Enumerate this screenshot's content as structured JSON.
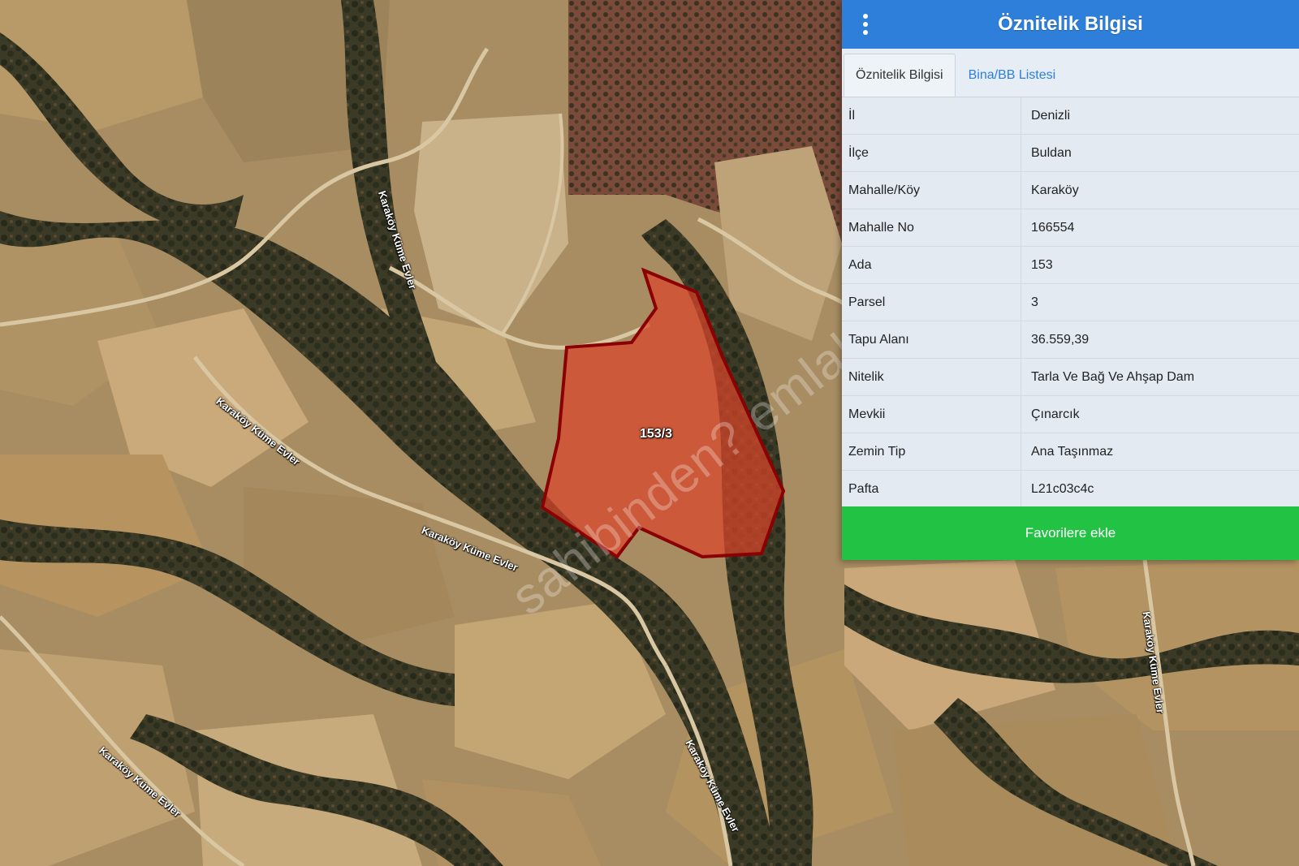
{
  "map": {
    "parcel_label": "153/3",
    "watermark": "sahibinden? emlakjet.com",
    "roads": [
      {
        "label": "Karaköy Küme Evler"
      },
      {
        "label": "Karaköy Küme Evler"
      },
      {
        "label": "Karaköy Küme Evler"
      },
      {
        "label": "Karaköy Küme Evler"
      },
      {
        "label": "Karaköy Küme Evler"
      },
      {
        "label": "Karaköy Küme Evler"
      }
    ]
  },
  "panel": {
    "title": "Öznitelik Bilgisi",
    "tabs": [
      {
        "label": "Öznitelik Bilgisi",
        "active": true
      },
      {
        "label": "Bina/BB Listesi",
        "active": false
      }
    ],
    "rows": [
      {
        "key": "İl",
        "value": "Denizli"
      },
      {
        "key": "İlçe",
        "value": "Buldan"
      },
      {
        "key": "Mahalle/Köy",
        "value": "Karaköy"
      },
      {
        "key": "Mahalle No",
        "value": "166554"
      },
      {
        "key": "Ada",
        "value": "153"
      },
      {
        "key": "Parsel",
        "value": "3"
      },
      {
        "key": "Tapu Alanı",
        "value": "36.559,39"
      },
      {
        "key": "Nitelik",
        "value": "Tarla Ve Bağ Ve Ahşap Dam"
      },
      {
        "key": "Mevkii",
        "value": "Çınarcık"
      },
      {
        "key": "Zemin Tip",
        "value": "Ana Taşınmaz"
      },
      {
        "key": "Pafta",
        "value": "L21c03c4c"
      }
    ],
    "favorite_button": "Favorilere ekle"
  },
  "colors": {
    "header": "#2e7fd9",
    "favorite": "#22c244",
    "parcel_fill": "#d9452a",
    "parcel_border": "#8b0000"
  }
}
